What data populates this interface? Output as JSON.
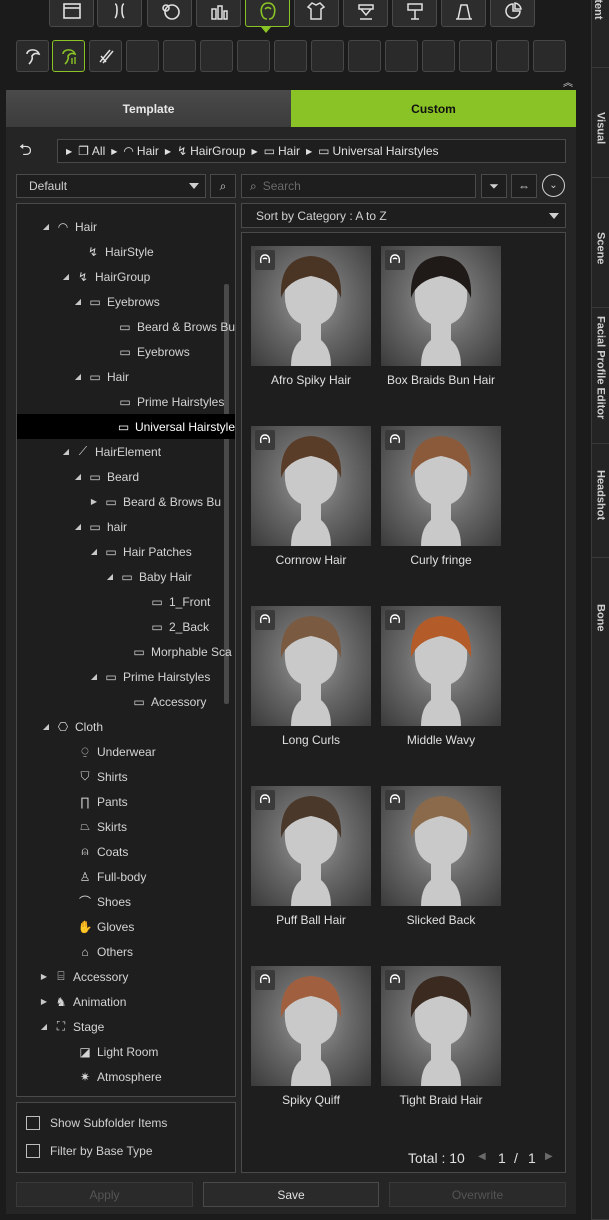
{
  "top_icons": [
    {
      "name": "scene-icon"
    },
    {
      "name": "character-icon"
    },
    {
      "name": "morph-icon"
    },
    {
      "name": "cosmetics-icon"
    },
    {
      "name": "hair-icon"
    },
    {
      "name": "cloth-icon"
    },
    {
      "name": "accessory-icon"
    },
    {
      "name": "pose-icon"
    },
    {
      "name": "stage-icon"
    },
    {
      "name": "pie-icon"
    }
  ],
  "sub_icons": [
    {
      "name": "hairstyle-icon"
    },
    {
      "name": "hairgroup-icon"
    },
    {
      "name": "hairelement-icon"
    }
  ],
  "side_tabs": [
    "Content",
    "Visual",
    "Scene",
    "Facial Profile Editor",
    "Headshot",
    "Bone"
  ],
  "tabs": {
    "template": "Template",
    "custom": "Custom"
  },
  "breadcrumb": {
    "items": [
      "All",
      "Hair",
      "HairGroup",
      "Hair",
      "Universal Hairstyles"
    ]
  },
  "filter": {
    "selected": "Default"
  },
  "search": {
    "placeholder": "Search"
  },
  "sort": {
    "selected": "Sort by Category : A to Z"
  },
  "tree": [
    {
      "label": "Hair",
      "icon": "hair-icon",
      "expanded": true
    },
    {
      "label": "HairStyle",
      "icon": "hairstyle-icon"
    },
    {
      "label": "HairGroup",
      "icon": "hairgroup-icon",
      "expanded": true
    },
    {
      "label": "Eyebrows",
      "icon": "folder-icon",
      "expanded": true
    },
    {
      "label": "Beard & Brows Bu",
      "icon": "folder-icon"
    },
    {
      "label": "Eyebrows",
      "icon": "folder-icon"
    },
    {
      "label": "Hair",
      "icon": "folder-icon",
      "expanded": true
    },
    {
      "label": "Prime Hairstyles",
      "icon": "folder-icon"
    },
    {
      "label": "Universal Hairstyle",
      "icon": "folder-icon",
      "selected": true
    },
    {
      "label": "HairElement",
      "icon": "hairelement-icon",
      "expanded": true
    },
    {
      "label": "Beard",
      "icon": "folder-icon",
      "expanded": true
    },
    {
      "label": "Beard & Brows Bu",
      "icon": "folder-icon",
      "collapsed": true
    },
    {
      "label": "hair",
      "icon": "folder-icon",
      "expanded": true
    },
    {
      "label": "Hair Patches",
      "icon": "folder-icon",
      "expanded": true
    },
    {
      "label": "Baby Hair",
      "icon": "folder-icon",
      "expanded": true
    },
    {
      "label": "1_Front",
      "icon": "folder-icon"
    },
    {
      "label": "2_Back",
      "icon": "folder-icon"
    },
    {
      "label": "Morphable Sca",
      "icon": "folder-icon"
    },
    {
      "label": "Prime Hairstyles",
      "icon": "folder-icon",
      "expanded": true
    },
    {
      "label": "Accessory",
      "icon": "folder-icon"
    },
    {
      "label": "Cloth",
      "icon": "cloth-icon",
      "expanded": true
    },
    {
      "label": "Underwear",
      "icon": "underwear-icon"
    },
    {
      "label": "Shirts",
      "icon": "shirt-icon"
    },
    {
      "label": "Pants",
      "icon": "pants-icon"
    },
    {
      "label": "Skirts",
      "icon": "skirt-icon"
    },
    {
      "label": "Coats",
      "icon": "coat-icon"
    },
    {
      "label": "Full-body",
      "icon": "fullbody-icon"
    },
    {
      "label": "Shoes",
      "icon": "shoe-icon"
    },
    {
      "label": "Gloves",
      "icon": "glove-icon"
    },
    {
      "label": "Others",
      "icon": "hanger-icon"
    },
    {
      "label": "Accessory",
      "icon": "accessory-icon",
      "collapsed": true
    },
    {
      "label": "Animation",
      "icon": "animation-icon",
      "collapsed": true
    },
    {
      "label": "Stage",
      "icon": "stage-icon",
      "expanded": true
    },
    {
      "label": "Light Room",
      "icon": "lightroom-icon"
    },
    {
      "label": "Atmosphere",
      "icon": "atmosphere-icon"
    }
  ],
  "options": {
    "show_subfolder": "Show Subfolder Items",
    "filter_base": "Filter by Base Type"
  },
  "items": [
    {
      "label": "Afro Spiky Hair",
      "hair_color": "#4a3424"
    },
    {
      "label": "Box Braids Bun Hair",
      "hair_color": "#1f1a17"
    },
    {
      "label": "Cornrow Hair",
      "hair_color": "#5a3d28"
    },
    {
      "label": "Curly fringe",
      "hair_color": "#8a5a3a"
    },
    {
      "label": "Long Curls",
      "hair_color": "#7a5a40"
    },
    {
      "label": "Middle Wavy",
      "hair_color": "#b35c2a"
    },
    {
      "label": "Puff Ball Hair",
      "hair_color": "#4a382a"
    },
    {
      "label": "Slicked Back",
      "hair_color": "#8a6a4a"
    },
    {
      "label": "Spiky Quiff",
      "hair_color": "#a06040"
    },
    {
      "label": "Tight Braid Hair",
      "hair_color": "#3a2a20"
    }
  ],
  "pagination": {
    "total": "Total : 10",
    "page": "1",
    "sep": "/",
    "pages": "1"
  },
  "buttons": {
    "apply": "Apply",
    "save": "Save",
    "overwrite": "Overwrite"
  },
  "colors": {
    "accent": "#8ac325",
    "panel": "#252525",
    "field": "#1e1e1e",
    "border": "#4a4a4a"
  }
}
